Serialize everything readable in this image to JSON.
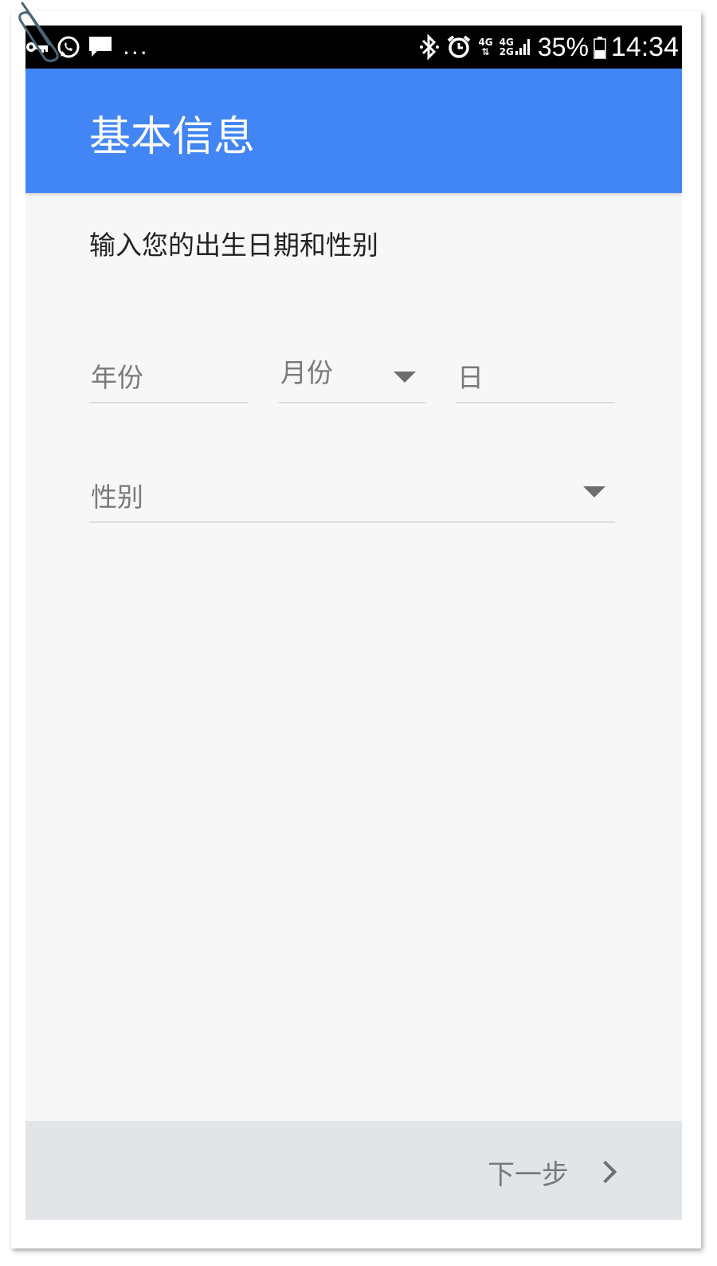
{
  "status_bar": {
    "battery_percent": "35%",
    "time": "14:34",
    "overflow": "...",
    "net_top": "4G",
    "net_bottom": "2G",
    "net_1": "4G",
    "icons_left": [
      "key-icon",
      "whatsapp-icon",
      "message-icon"
    ],
    "icons_right": [
      "bluetooth-icon",
      "alarm-icon",
      "signal-4g-icon",
      "signal-4g-2g-icon",
      "battery-icon"
    ]
  },
  "app_bar": {
    "title": "基本信息"
  },
  "form": {
    "instruction": "输入您的出生日期和性别",
    "year_label": "年份",
    "month_label": "月份",
    "day_label": "日",
    "gender_label": "性别"
  },
  "footer": {
    "next_label": "下一步"
  },
  "colors": {
    "app_bar": "#4285f4",
    "status_bar": "#000000",
    "background": "#f7f7f7",
    "bottom_bar": "#e2e5e8"
  }
}
